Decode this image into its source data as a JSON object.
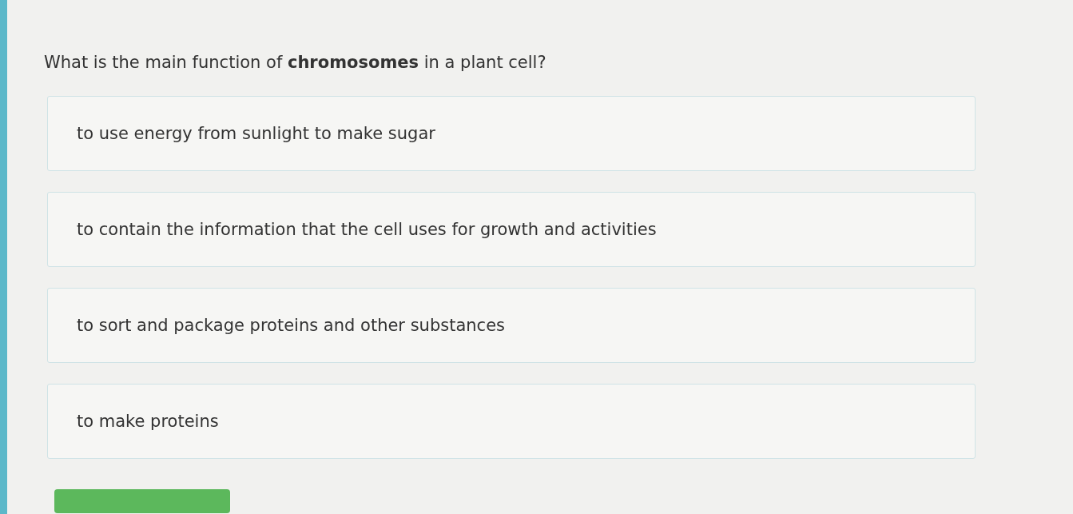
{
  "question": "What is the main function of **chromosomes** in a plant cell?",
  "options": [
    {
      "label": "to use energy from sunlight to make sugar",
      "selected": false
    },
    {
      "label": "to contain the information that the cell uses for growth and activities",
      "selected": false
    },
    {
      "label": "to sort and package proteins and other substances",
      "selected": false
    },
    {
      "label": "to make proteins",
      "selected": false
    }
  ]
}
